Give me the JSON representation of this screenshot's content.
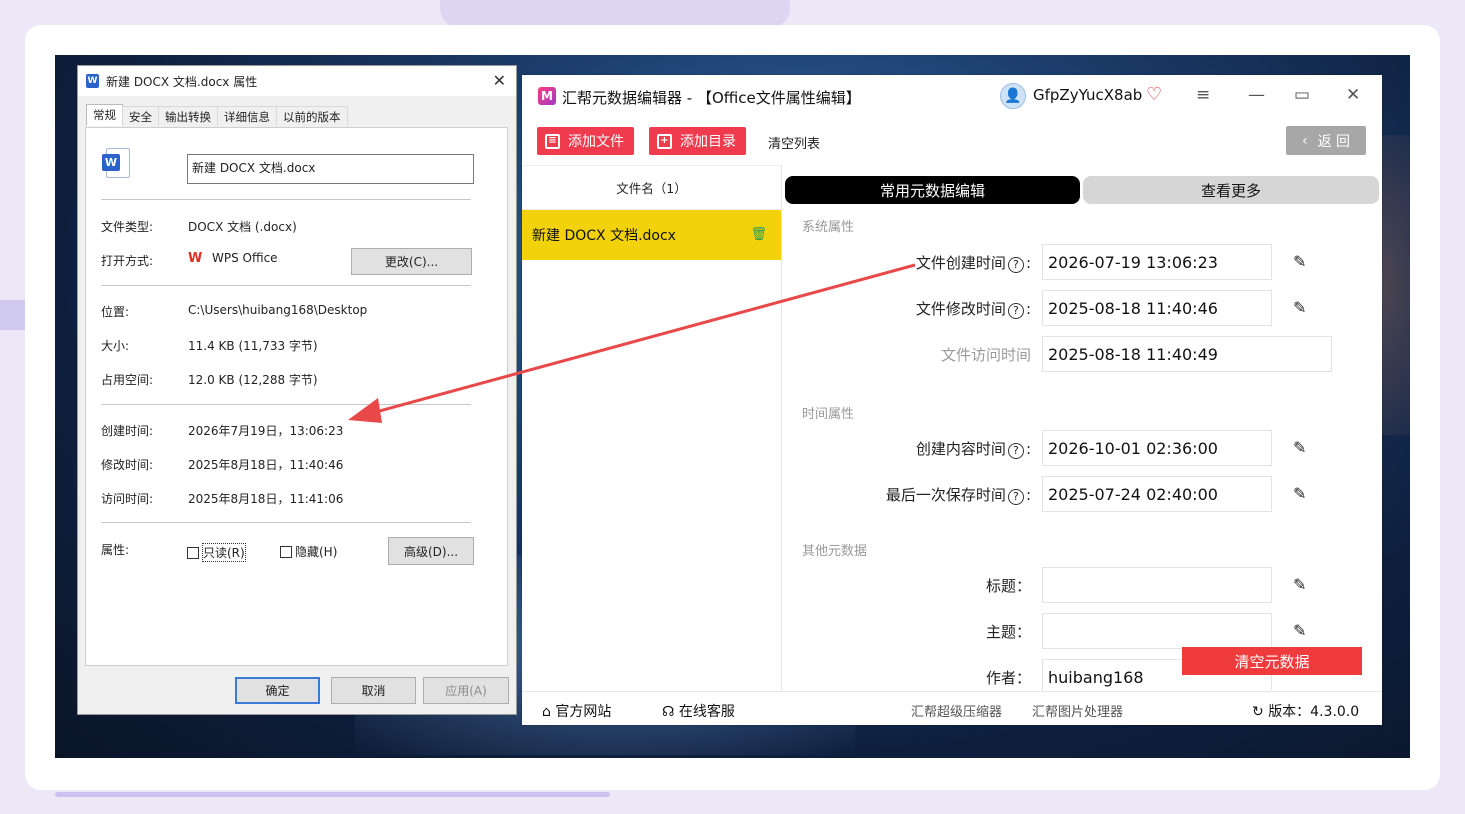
{
  "props_dialog": {
    "title": "新建 DOCX 文档.docx 属性",
    "tabs": [
      "常规",
      "安全",
      "输出转换",
      "详细信息",
      "以前的版本"
    ],
    "filename": "新建 DOCX 文档.docx",
    "file_type_label": "文件类型:",
    "file_type_value": "DOCX 文档 (.docx)",
    "open_with_label": "打开方式:",
    "open_with_value": "WPS Office",
    "change_button": "更改(C)...",
    "location_label": "位置:",
    "location_value": "C:\\Users\\huibang168\\Desktop",
    "size_label": "大小:",
    "size_value": "11.4 KB (11,733 字节)",
    "disk_size_label": "占用空间:",
    "disk_size_value": "12.0 KB (12,288 字节)",
    "created_label": "创建时间:",
    "created_value": "2026年7月19日，13:06:23",
    "modified_label": "修改时间:",
    "modified_value": "2025年8月18日，11:40:46",
    "accessed_label": "访问时间:",
    "accessed_value": "2025年8月18日，11:41:06",
    "attributes_label": "属性:",
    "readonly_label": "只读(R)",
    "hidden_label": "隐藏(H)",
    "advanced_button": "高级(D)...",
    "ok_button": "确定",
    "cancel_button": "取消",
    "apply_button": "应用(A)"
  },
  "app": {
    "title": "汇帮元数据编辑器 - 【Office文件属性编辑】",
    "username": "GfpZyYucX8ab",
    "add_file": "添加文件",
    "add_dir": "添加目录",
    "clear_list": "清空列表",
    "back": "返 回",
    "file_list_header": "文件名（1）",
    "files": [
      "新建 DOCX 文档.docx"
    ],
    "tab_common": "常用元数据编辑",
    "tab_more": "查看更多",
    "sections": {
      "system": "系统属性",
      "time": "时间属性",
      "other": "其他元数据"
    },
    "fields": {
      "file_created_label": "文件创建时间",
      "file_created_value": "2026-07-19 13:06:23",
      "file_modified_label": "文件修改时间",
      "file_modified_value": "2025-08-18 11:40:46",
      "file_accessed_label": "文件访问时间",
      "file_accessed_value": "2025-08-18 11:40:49",
      "content_created_label": "创建内容时间",
      "content_created_value": "2026-10-01 02:36:00",
      "last_saved_label": "最后一次保存时间",
      "last_saved_value": "2025-07-24 02:40:00",
      "title_label": "标题：",
      "title_value": "",
      "subject_label": "主题：",
      "subject_value": "",
      "author_label": "作者：",
      "author_value": "huibang168"
    },
    "help_mark": "?",
    "colon": ":",
    "clear_metadata": "清空元数据",
    "footer": {
      "website": "官方网站",
      "support": "在线客服",
      "compressor": "汇帮超级压缩器",
      "image_tool": "汇帮图片处理器",
      "version": "版本：4.3.0.0"
    }
  },
  "colors": {
    "accent_red": "#ef3b4d",
    "file_highlight": "#f1d20b",
    "arrow": "#e84848"
  }
}
